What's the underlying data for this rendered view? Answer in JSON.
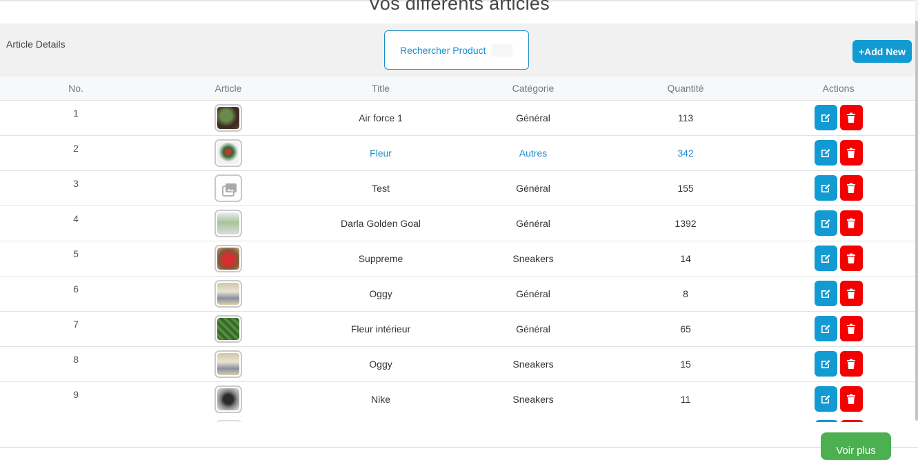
{
  "page": {
    "title": "Vos différents articles"
  },
  "toolbar": {
    "label": "Article Details",
    "search_placeholder": "Rechercher Product",
    "add_label": "+Add New"
  },
  "table": {
    "headers": [
      "No.",
      "Article",
      "Title",
      "Catégorie",
      "Quantité",
      "Actions"
    ],
    "rows": [
      {
        "no": "1",
        "title": "Air force 1",
        "category": "Général",
        "quantity": "113",
        "thumb": "plant-photo"
      },
      {
        "no": "2",
        "title": "Fleur",
        "category": "Autres",
        "quantity": "342",
        "thumb": "flower-photo"
      },
      {
        "no": "3",
        "title": "Test",
        "category": "Général",
        "quantity": "155",
        "thumb": "image-placeholder-icon"
      },
      {
        "no": "4",
        "title": "Darla Golden Goal",
        "category": "Général",
        "quantity": "1392",
        "thumb": "plant-vase-photo"
      },
      {
        "no": "5",
        "title": "Suppreme",
        "category": "Sneakers",
        "quantity": "14",
        "thumb": "red-sneaker-photo"
      },
      {
        "no": "6",
        "title": "Oggy",
        "category": "Général",
        "quantity": "8",
        "thumb": "shoe-box-photo"
      },
      {
        "no": "7",
        "title": "Fleur intérieur",
        "category": "Général",
        "quantity": "65",
        "thumb": "green-plant-photo"
      },
      {
        "no": "8",
        "title": "Oggy",
        "category": "Sneakers",
        "quantity": "15",
        "thumb": "shoe-box-photo"
      },
      {
        "no": "9",
        "title": "Nike",
        "category": "Sneakers",
        "quantity": "11",
        "thumb": "black-sneaker-photo"
      }
    ]
  },
  "footer": {
    "more_label": "Voir plus"
  },
  "icons": {
    "edit": "edit-icon",
    "delete": "trash-icon",
    "placeholder": "image-placeholder-icon"
  },
  "colors": {
    "primary": "#119bd2",
    "danger": "#f50000",
    "success": "#4caf50",
    "highlight_text": "#1c8ec9"
  }
}
